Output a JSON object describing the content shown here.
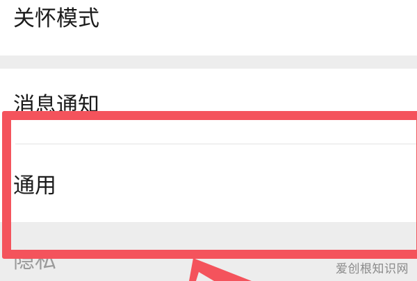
{
  "settings": {
    "items": [
      {
        "label": "关怀模式"
      },
      {
        "label": "消息通知"
      },
      {
        "label": "通用"
      },
      {
        "label": "隐私"
      }
    ]
  },
  "annotation": {
    "box_color": "#f4535c",
    "arrow_color": "#f4535c",
    "target": "通用"
  },
  "watermark": {
    "text": "爱创根知识网"
  }
}
